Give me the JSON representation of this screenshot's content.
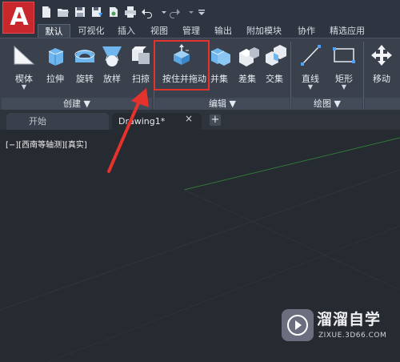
{
  "app": {
    "logo_letter": "A"
  },
  "quick_access": {
    "icons": [
      "new-icon",
      "open-icon",
      "save-icon",
      "save-as-icon",
      "share-icon",
      "print-icon",
      "undo-icon",
      "undo-dropdown-icon",
      "redo-icon",
      "redo-dropdown-icon",
      "customize-dropdown-icon"
    ]
  },
  "ribbon_tabs": [
    "默认",
    "可视化",
    "插入",
    "视图",
    "管理",
    "输出",
    "附加模块",
    "协作",
    "精选应用"
  ],
  "active_tab": "默认",
  "tools": {
    "loft": "楔体",
    "extrude": "拉伸",
    "revolve": "旋转",
    "sweep_loft": "放样",
    "sweep": "扫掠",
    "presspull": "按住并拖动",
    "union": "并集",
    "subtract": "差集",
    "intersect": "交集",
    "line": "直线",
    "rectangle": "矩形",
    "move": "移动"
  },
  "panels": {
    "create": "创建 ▼",
    "edit": "编辑 ▼",
    "draw": "绘图 ▼"
  },
  "file_tabs": {
    "start": "开始",
    "drawing": "Drawing1*",
    "close": "×",
    "add": "+"
  },
  "viewport": {
    "label": "[−][西南等轴测][真实]"
  },
  "watermark": {
    "title": "溜溜自学",
    "subtitle": "ZIXUE.3D66.COM"
  },
  "colors": {
    "accent_red": "#e5322d",
    "logo_red": "#c8272c",
    "ribbon_bg": "#3a414d",
    "viewport_bg": "#262a31"
  }
}
